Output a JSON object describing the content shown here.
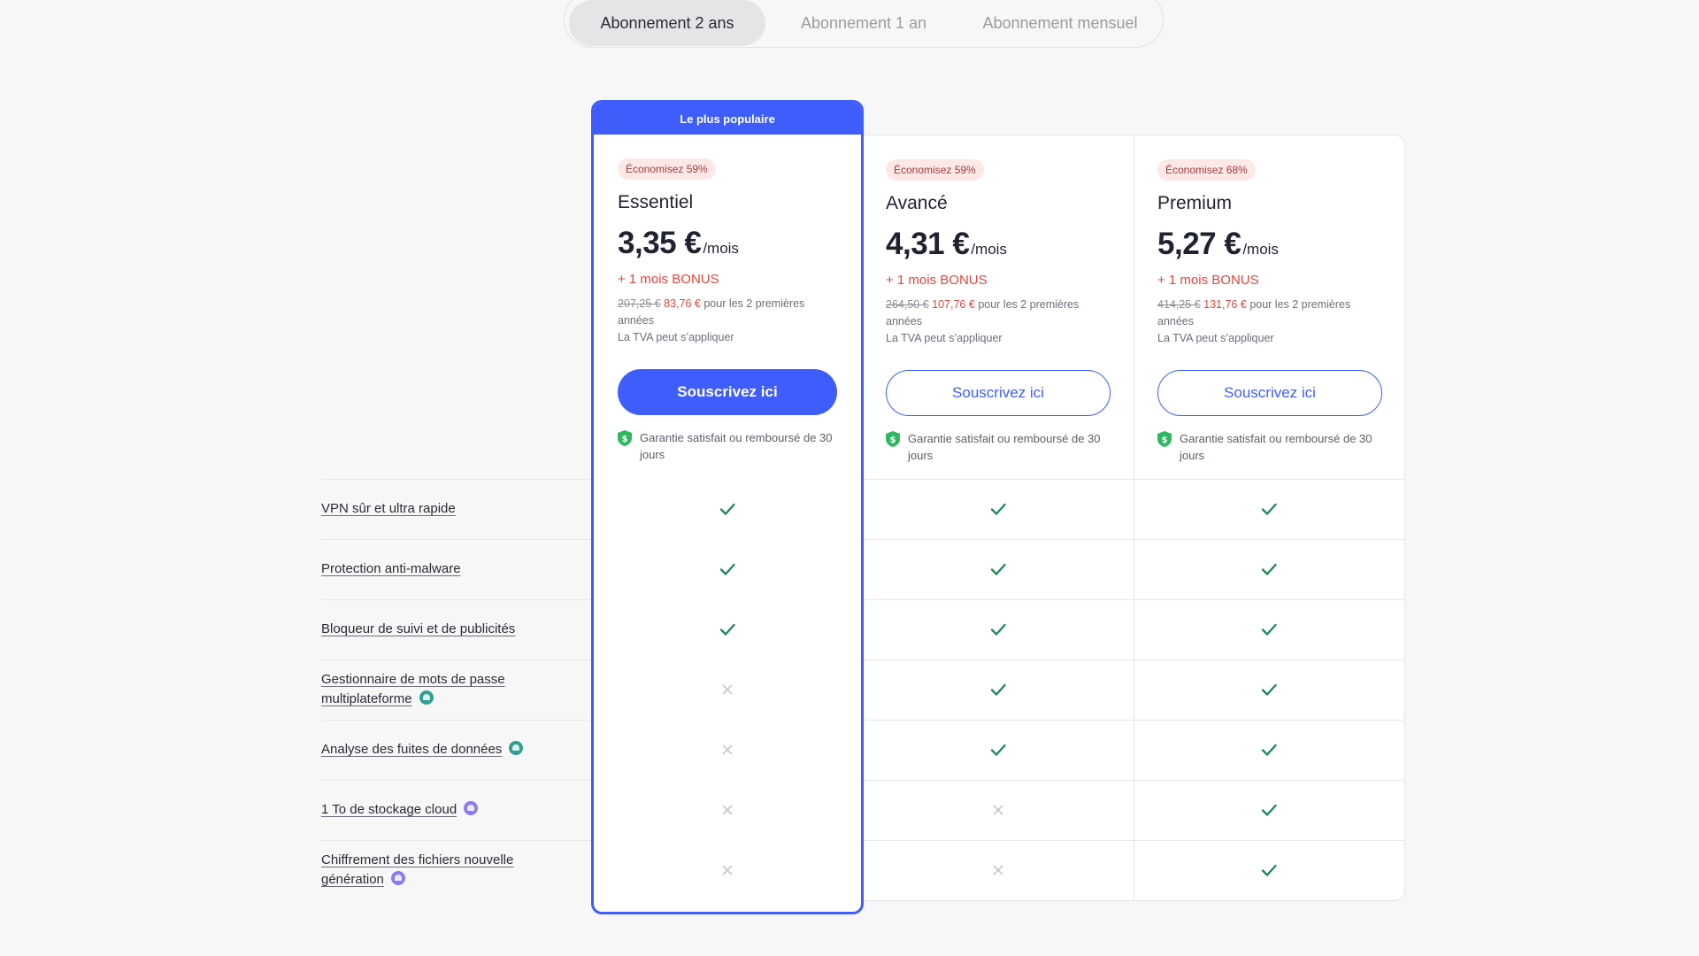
{
  "tabs": [
    {
      "label": "Abonnement 2 ans",
      "active": true
    },
    {
      "label": "Abonnement 1 an",
      "active": false
    },
    {
      "label": "Abonnement mensuel",
      "active": false
    }
  ],
  "popular_label": "Le plus populaire",
  "plans": [
    {
      "badge": "Économisez 59%",
      "name": "Essentiel",
      "price": "3,35 €",
      "per": "/mois",
      "bonus": "+ 1 mois BONUS",
      "old_price": "207,25 €",
      "new_price": "83,76 €",
      "period_text": "pour les 2 premières années",
      "vat": "La TVA peut s’appliquer",
      "cta": "Souscrivez ici",
      "guarantee": "Garantie satisfait ou remboursé de 30 jours"
    },
    {
      "badge": "Économisez 59%",
      "name": "Avancé",
      "price": "4,31 €",
      "per": "/mois",
      "bonus": "+ 1 mois BONUS",
      "old_price": "264,50 €",
      "new_price": "107,76 €",
      "period_text": "pour les 2 premières années",
      "vat": "La TVA peut s’appliquer",
      "cta": "Souscrivez ici",
      "guarantee": "Garantie satisfait ou remboursé de 30 jours"
    },
    {
      "badge": "Économisez 68%",
      "name": "Premium",
      "price": "5,27 €",
      "per": "/mois",
      "bonus": "+ 1 mois BONUS",
      "old_price": "414,25 €",
      "new_price": "131,76 €",
      "period_text": "pour les 2 premières années",
      "vat": "La TVA peut s’appliquer",
      "cta": "Souscrivez ici",
      "guarantee": "Garantie satisfait ou remboursé de 30 jours"
    }
  ],
  "features": [
    {
      "label": "VPN sûr et ultra rapide",
      "icon": "",
      "included": [
        true,
        true,
        true
      ]
    },
    {
      "label": "Protection anti-malware",
      "icon": "",
      "included": [
        true,
        true,
        true
      ]
    },
    {
      "label": "Bloqueur de suivi et de publicités",
      "icon": "",
      "included": [
        true,
        true,
        true
      ]
    },
    {
      "label": "Gestionnaire de mots de passe multiplateforme",
      "icon": "password-manager-icon",
      "included": [
        false,
        true,
        true
      ]
    },
    {
      "label": "Analyse des fuites de données",
      "icon": "password-manager-icon",
      "included": [
        false,
        true,
        true
      ]
    },
    {
      "label": "1 To de stockage cloud",
      "icon": "cloud-storage-icon",
      "included": [
        false,
        false,
        true
      ]
    },
    {
      "label": "Chiffrement des fichiers nouvelle génération",
      "icon": "cloud-storage-icon",
      "included": [
        false,
        false,
        true
      ]
    }
  ],
  "colors": {
    "accent": "#3f5dfb",
    "check": "#1f8a5b",
    "cross": "#c8cad0",
    "discount": "#e0463e",
    "shield": "#2fb860"
  }
}
